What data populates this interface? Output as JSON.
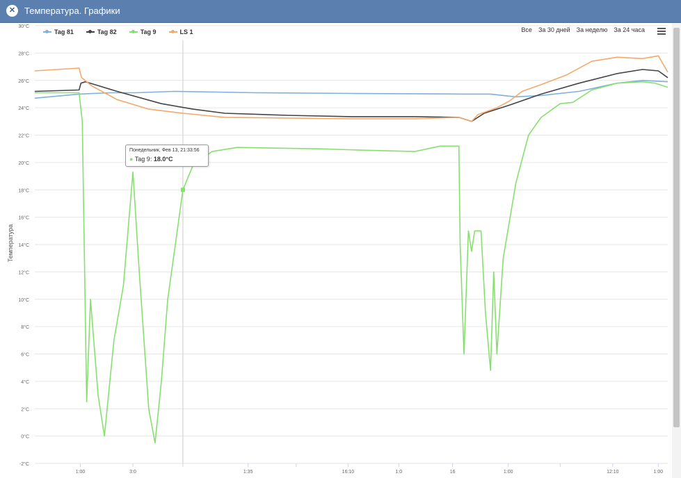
{
  "window": {
    "title": "Температура. Графики",
    "close_glyph": "✕",
    "close_icon": "close-icon"
  },
  "controls": {
    "ranges": [
      "Все",
      "За 30 дней",
      "За неделю",
      "За 24 часа"
    ],
    "menu_icon": "hamburger-menu-icon"
  },
  "tooltip": {
    "header": "Понедельник, Фев 13, 21:33:56",
    "series": "Tag 9",
    "value": "18.0°C",
    "color": "#86e06e"
  },
  "chart_data": {
    "type": "line",
    "ylabel": "Температура",
    "ylim": [
      -2,
      30
    ],
    "y_ticks": [
      "30°C",
      "28°C",
      "26°C",
      "24°C",
      "22°C",
      "20°C",
      "18°C",
      "16°C",
      "14°C",
      "12°C",
      "10°C",
      "8°C",
      "6°C",
      "4°C",
      "2°C",
      "0°C",
      "-2°C"
    ],
    "y_tick_values": [
      30,
      28,
      26,
      24,
      22,
      20,
      18,
      16,
      14,
      12,
      10,
      8,
      6,
      4,
      2,
      0,
      -2
    ],
    "x_ticks": [
      "1:00",
      "3:0",
      "",
      "1:35",
      "",
      "16:10",
      "1:0",
      "16",
      "1:00",
      "",
      "12:10",
      "1:00"
    ],
    "x_tick_positions": [
      0.072,
      0.155,
      0.234,
      0.337,
      0.413,
      0.495,
      0.575,
      0.66,
      0.748,
      0.83,
      0.913,
      0.985
    ],
    "grid": true,
    "legend_position": "top-left",
    "crosshair_x": 0.234,
    "series": [
      {
        "name": "Tag 81",
        "color": "#7fb1dc",
        "points": [
          [
            0,
            24.7
          ],
          [
            0.07,
            25
          ],
          [
            0.12,
            25.1
          ],
          [
            0.16,
            25.1
          ],
          [
            0.22,
            25.2
          ],
          [
            0.35,
            25.1
          ],
          [
            0.5,
            25.05
          ],
          [
            0.68,
            25
          ],
          [
            0.72,
            25
          ],
          [
            0.76,
            24.8
          ],
          [
            0.8,
            24.9
          ],
          [
            0.86,
            25.2
          ],
          [
            0.92,
            25.8
          ],
          [
            0.96,
            26
          ],
          [
            1,
            25.9
          ]
        ]
      },
      {
        "name": "Tag 82",
        "color": "#434348",
        "points": [
          [
            0,
            25.2
          ],
          [
            0.07,
            25.3
          ],
          [
            0.073,
            25.8
          ],
          [
            0.08,
            25.9
          ],
          [
            0.13,
            25.2
          ],
          [
            0.2,
            24.3
          ],
          [
            0.25,
            23.9
          ],
          [
            0.3,
            23.6
          ],
          [
            0.4,
            23.45
          ],
          [
            0.5,
            23.35
          ],
          [
            0.6,
            23.35
          ],
          [
            0.67,
            23.3
          ],
          [
            0.69,
            23
          ],
          [
            0.71,
            23.6
          ],
          [
            0.75,
            24.2
          ],
          [
            0.8,
            25
          ],
          [
            0.86,
            25.8
          ],
          [
            0.92,
            26.5
          ],
          [
            0.96,
            26.8
          ],
          [
            0.985,
            26.7
          ],
          [
            1,
            26.2
          ]
        ]
      },
      {
        "name": "Tag 9",
        "color": "#86e06e",
        "points": [
          [
            0,
            25.1
          ],
          [
            0.07,
            25.1
          ],
          [
            0.075,
            23
          ],
          [
            0.082,
            2.5
          ],
          [
            0.088,
            10
          ],
          [
            0.1,
            3
          ],
          [
            0.11,
            0
          ],
          [
            0.125,
            7
          ],
          [
            0.14,
            11
          ],
          [
            0.155,
            19.3
          ],
          [
            0.165,
            12
          ],
          [
            0.18,
            2
          ],
          [
            0.19,
            -0.5
          ],
          [
            0.2,
            4
          ],
          [
            0.21,
            10
          ],
          [
            0.225,
            15
          ],
          [
            0.234,
            18
          ],
          [
            0.25,
            19.8
          ],
          [
            0.28,
            20.8
          ],
          [
            0.32,
            21.1
          ],
          [
            0.38,
            21.05
          ],
          [
            0.45,
            21
          ],
          [
            0.52,
            20.9
          ],
          [
            0.6,
            20.8
          ],
          [
            0.64,
            21.2
          ],
          [
            0.67,
            21.2
          ],
          [
            0.672,
            14
          ],
          [
            0.678,
            6
          ],
          [
            0.685,
            15
          ],
          [
            0.69,
            13.5
          ],
          [
            0.695,
            15
          ],
          [
            0.705,
            15
          ],
          [
            0.712,
            9
          ],
          [
            0.72,
            4.8
          ],
          [
            0.725,
            12
          ],
          [
            0.73,
            6
          ],
          [
            0.74,
            13
          ],
          [
            0.76,
            18.5
          ],
          [
            0.78,
            22
          ],
          [
            0.8,
            23.3
          ],
          [
            0.83,
            24.3
          ],
          [
            0.85,
            24.4
          ],
          [
            0.88,
            25.3
          ],
          [
            0.92,
            25.8
          ],
          [
            0.96,
            25.9
          ],
          [
            0.98,
            25.8
          ],
          [
            1,
            25.5
          ]
        ]
      },
      {
        "name": "LS 1",
        "color": "#f4a96a",
        "points": [
          [
            0,
            26.7
          ],
          [
            0.07,
            26.9
          ],
          [
            0.074,
            26.2
          ],
          [
            0.09,
            25.6
          ],
          [
            0.13,
            24.6
          ],
          [
            0.18,
            23.9
          ],
          [
            0.234,
            23.6
          ],
          [
            0.3,
            23.3
          ],
          [
            0.4,
            23.25
          ],
          [
            0.5,
            23.2
          ],
          [
            0.6,
            23.2
          ],
          [
            0.67,
            23.3
          ],
          [
            0.69,
            23
          ],
          [
            0.7,
            23.5
          ],
          [
            0.73,
            24
          ],
          [
            0.75,
            24.5
          ],
          [
            0.77,
            25.2
          ],
          [
            0.8,
            25.7
          ],
          [
            0.84,
            26.4
          ],
          [
            0.88,
            27.4
          ],
          [
            0.92,
            27.7
          ],
          [
            0.96,
            27.6
          ],
          [
            0.985,
            27.8
          ],
          [
            1,
            26.6
          ]
        ]
      }
    ]
  }
}
